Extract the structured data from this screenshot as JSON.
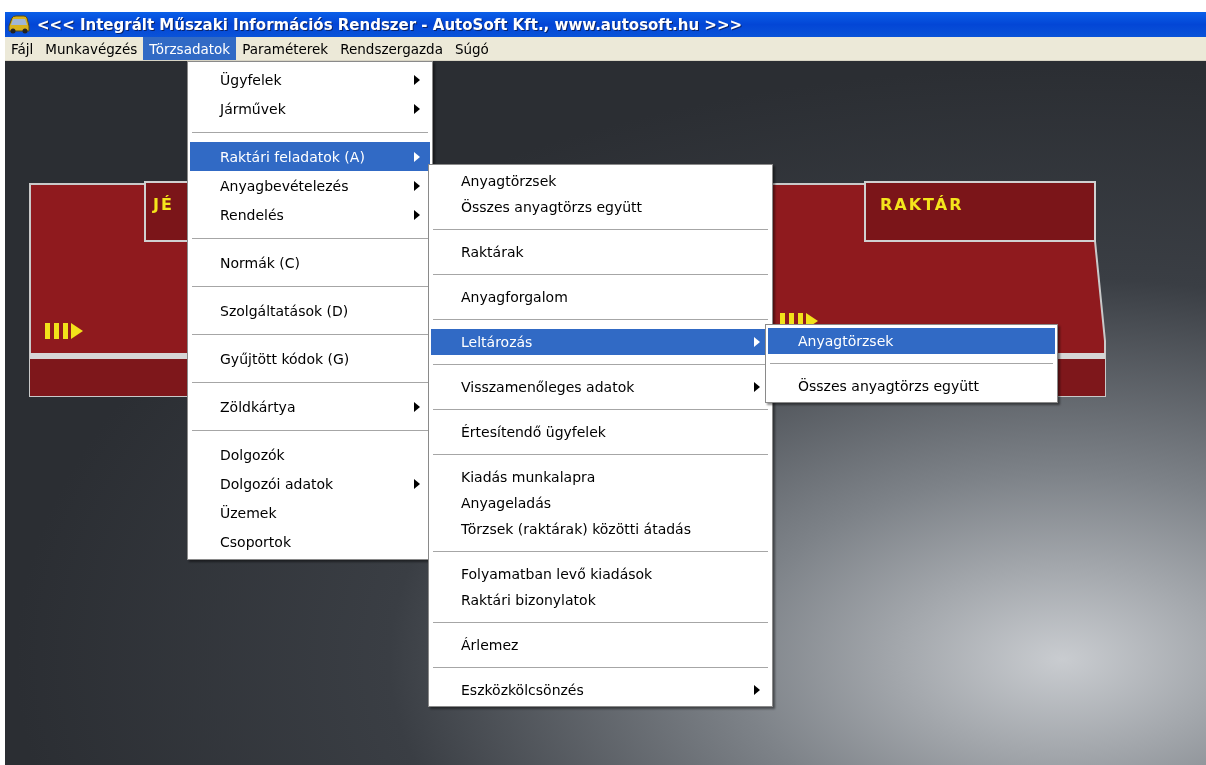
{
  "window": {
    "title": "<<< Integrált Műszaki Információs Rendszer - AutoSoft Kft., www.autosoft.hu >>>"
  },
  "menubar": [
    {
      "label": "Fájl",
      "selected": false
    },
    {
      "label": "Munkavégzés",
      "selected": false
    },
    {
      "label": "Törzsadatok",
      "selected": true
    },
    {
      "label": "Paraméterek",
      "selected": false
    },
    {
      "label": "Rendszergazda",
      "selected": false
    },
    {
      "label": "Súgó",
      "selected": false
    }
  ],
  "panel": {
    "left_label": "JÉ",
    "right_label": "RAKTÁR"
  },
  "menus": [
    {
      "items": [
        {
          "kind": "item",
          "label": "Ügyfelek",
          "submenu": true,
          "selected": false
        },
        {
          "kind": "item",
          "label": "Járművek",
          "submenu": true,
          "selected": false
        },
        {
          "kind": "separator"
        },
        {
          "kind": "item",
          "label": "Raktári feladatok (A)",
          "submenu": true,
          "selected": true
        },
        {
          "kind": "item",
          "label": "Anyagbevételezés",
          "submenu": true,
          "selected": false
        },
        {
          "kind": "item",
          "label": "Rendelés",
          "submenu": true,
          "selected": false
        },
        {
          "kind": "separator"
        },
        {
          "kind": "item",
          "label": "Normák (C)",
          "submenu": false,
          "selected": false
        },
        {
          "kind": "separator"
        },
        {
          "kind": "item",
          "label": "Szolgáltatások (D)",
          "submenu": false,
          "selected": false
        },
        {
          "kind": "separator"
        },
        {
          "kind": "item",
          "label": "Gyűjtött kódok (G)",
          "submenu": false,
          "selected": false
        },
        {
          "kind": "separator"
        },
        {
          "kind": "item",
          "label": "Zöldkártya",
          "submenu": true,
          "selected": false
        },
        {
          "kind": "separator"
        },
        {
          "kind": "item",
          "label": "Dolgozók",
          "submenu": false,
          "selected": false
        },
        {
          "kind": "item",
          "label": "Dolgozói adatok",
          "submenu": true,
          "selected": false
        },
        {
          "kind": "item",
          "label": "Üzemek",
          "submenu": false,
          "selected": false
        },
        {
          "kind": "item",
          "label": "Csoportok",
          "submenu": false,
          "selected": false
        }
      ]
    },
    {
      "items": [
        {
          "kind": "item",
          "label": "Anyagtörzsek",
          "submenu": false,
          "selected": false
        },
        {
          "kind": "item",
          "label": "Összes anyagtörzs együtt",
          "submenu": false,
          "selected": false
        },
        {
          "kind": "separator"
        },
        {
          "kind": "item",
          "label": "Raktárak",
          "submenu": false,
          "selected": false
        },
        {
          "kind": "separator"
        },
        {
          "kind": "item",
          "label": "Anyagforgalom",
          "submenu": false,
          "selected": false
        },
        {
          "kind": "separator"
        },
        {
          "kind": "item",
          "label": "Leltározás",
          "submenu": true,
          "selected": true
        },
        {
          "kind": "separator"
        },
        {
          "kind": "item",
          "label": "Visszamenőleges adatok",
          "submenu": true,
          "selected": false
        },
        {
          "kind": "separator"
        },
        {
          "kind": "item",
          "label": "Értesítendő ügyfelek",
          "submenu": false,
          "selected": false
        },
        {
          "kind": "separator"
        },
        {
          "kind": "item",
          "label": "Kiadás munkalapra",
          "submenu": false,
          "selected": false
        },
        {
          "kind": "item",
          "label": "Anyageladás",
          "submenu": false,
          "selected": false
        },
        {
          "kind": "item",
          "label": "Törzsek (raktárak) közötti átadás",
          "submenu": false,
          "selected": false
        },
        {
          "kind": "separator"
        },
        {
          "kind": "item",
          "label": "Folyamatban levő kiadások",
          "submenu": false,
          "selected": false
        },
        {
          "kind": "item",
          "label": "Raktári bizonylatok",
          "submenu": false,
          "selected": false
        },
        {
          "kind": "separator"
        },
        {
          "kind": "item",
          "label": "Árlemez",
          "submenu": false,
          "selected": false
        },
        {
          "kind": "separator"
        },
        {
          "kind": "item",
          "label": "Eszközkölcsönzés",
          "submenu": true,
          "selected": false
        }
      ]
    },
    {
      "items": [
        {
          "kind": "item",
          "label": "Anyagtörzsek",
          "submenu": false,
          "selected": true
        },
        {
          "kind": "separator"
        },
        {
          "kind": "item",
          "label": "Összes anyagtörzs együtt",
          "submenu": false,
          "selected": false
        }
      ]
    }
  ]
}
